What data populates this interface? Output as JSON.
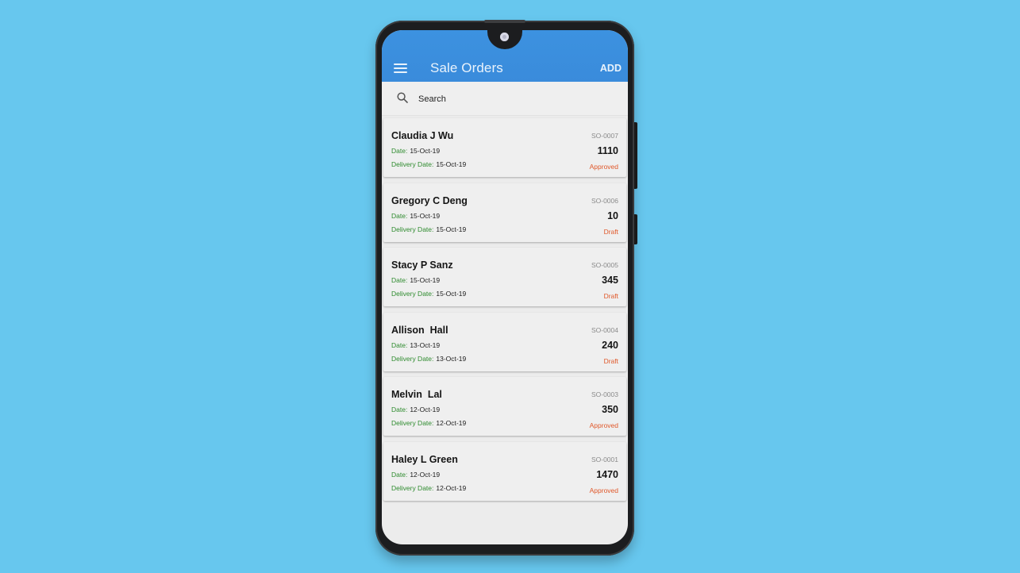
{
  "app": {
    "title": "Sale Orders",
    "add_label": "ADD",
    "menu_icon": "hamburger-menu-icon"
  },
  "search": {
    "placeholder": "Search",
    "value": "",
    "icon": "search-icon"
  },
  "labels": {
    "date": "Date:",
    "delivery_date": "Delivery Date:"
  },
  "colors": {
    "appbar": "#3a8fde",
    "label_green": "#2e8b2e",
    "status_orange": "#e0582a",
    "background": "#67c7ee"
  },
  "orders": [
    {
      "name": "Claudia J Wu",
      "date": "15-Oct-19",
      "delivery_date": "15-Oct-19",
      "code": "SO-0007",
      "amount": "1110",
      "status": "Approved"
    },
    {
      "name": "Gregory C Deng",
      "date": "15-Oct-19",
      "delivery_date": "15-Oct-19",
      "code": "SO-0006",
      "amount": "10",
      "status": "Draft"
    },
    {
      "name": "Stacy P Sanz",
      "date": "15-Oct-19",
      "delivery_date": "15-Oct-19",
      "code": "SO-0005",
      "amount": "345",
      "status": "Draft"
    },
    {
      "name": "Allison  Hall",
      "date": "13-Oct-19",
      "delivery_date": "13-Oct-19",
      "code": "SO-0004",
      "amount": "240",
      "status": "Draft"
    },
    {
      "name": "Melvin  Lal",
      "date": "12-Oct-19",
      "delivery_date": "12-Oct-19",
      "code": "SO-0003",
      "amount": "350",
      "status": "Approved"
    },
    {
      "name": "Haley L Green",
      "date": "12-Oct-19",
      "delivery_date": "12-Oct-19",
      "code": "SO-0001",
      "amount": "1470",
      "status": "Approved"
    }
  ]
}
